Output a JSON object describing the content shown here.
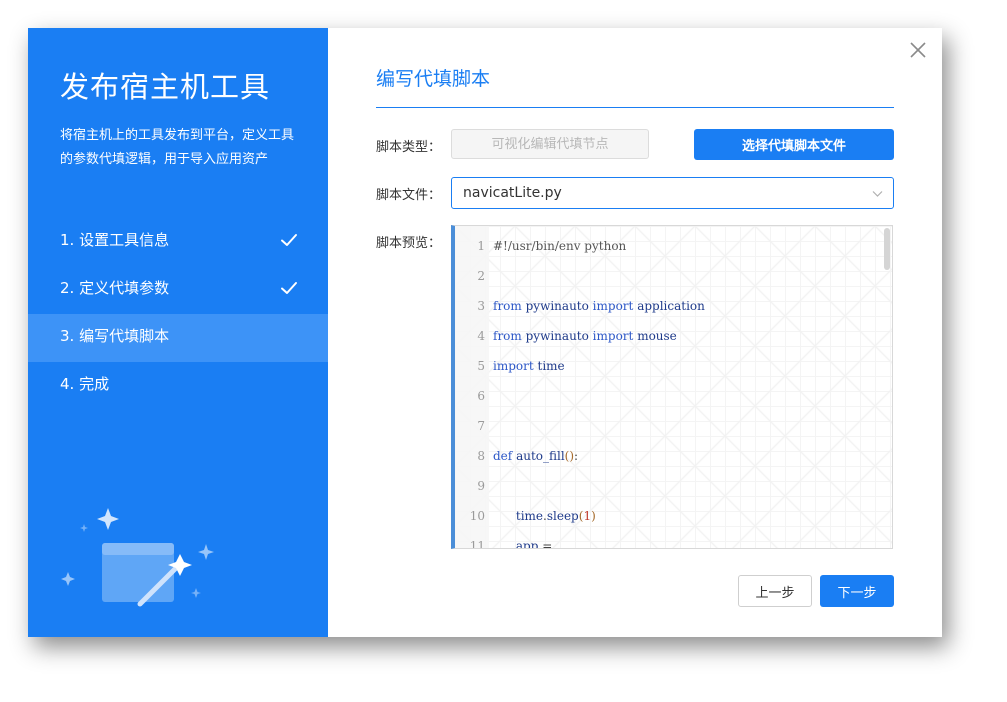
{
  "sidebar": {
    "title": "发布宿主机工具",
    "description": "将宿主机上的工具发布到平台，定义工具的参数代填逻辑，用于导入应用资产",
    "steps": [
      {
        "label": "1. 设置工具信息",
        "completed": true,
        "active": false
      },
      {
        "label": "2. 定义代填参数",
        "completed": true,
        "active": false
      },
      {
        "label": "3. 编写代填脚本",
        "completed": false,
        "active": true
      },
      {
        "label": "4. 完成",
        "completed": false,
        "active": false
      }
    ],
    "check_icon": "check-icon",
    "illustration_icon": "magic-wand-window-icon"
  },
  "main": {
    "title": "编写代填脚本",
    "close_icon": "close-icon",
    "script_type": {
      "label": "脚本类型：",
      "value": "可视化编辑代填节点",
      "disabled": true
    },
    "choose_file_button": "选择代填脚本文件",
    "script_file": {
      "label": "脚本文件：",
      "value": "navicatLite.py",
      "dropdown_icon": "chevron-down-icon"
    },
    "script_preview": {
      "label": "脚本预览：",
      "lines": [
        {
          "num": "1",
          "code": "#!/usr/bin/env python"
        },
        {
          "num": "2",
          "code": ""
        },
        {
          "num": "3",
          "code": "from pywinauto import application"
        },
        {
          "num": "4",
          "code": "from pywinauto import mouse"
        },
        {
          "num": "5",
          "code": "import time"
        },
        {
          "num": "6",
          "code": ""
        },
        {
          "num": "7",
          "code": ""
        },
        {
          "num": "8",
          "code": "def auto_fill():"
        },
        {
          "num": "9",
          "code": ""
        },
        {
          "num": "10",
          "code": "      time.sleep(1)"
        },
        {
          "num": "11",
          "code": "      app ="
        }
      ]
    },
    "prev_button": "上一步",
    "next_button": "下一步"
  },
  "colors": {
    "accent": "#1a7ef3",
    "sidebar_active": "#3d93f7",
    "code_gutter_bar": "#4b8ed8",
    "disabled_bg": "#f5f5f5"
  }
}
